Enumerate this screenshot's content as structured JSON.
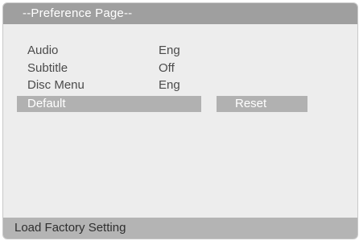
{
  "header": {
    "title": "--Preference Page--"
  },
  "menu": {
    "items": [
      {
        "label": "Audio",
        "value": "Eng"
      },
      {
        "label": "Subtitle",
        "value": "Off"
      },
      {
        "label": "Disc Menu",
        "value": "Eng"
      }
    ],
    "selected_item": "Default",
    "reset_label": "Reset"
  },
  "footer": {
    "status_text": "Load Factory Setting"
  },
  "colors": {
    "title_bar": "#9f9f9f",
    "highlight": "#b1b1b1",
    "screen_background": "#ededed",
    "footer_bar": "#b4b4b4"
  }
}
